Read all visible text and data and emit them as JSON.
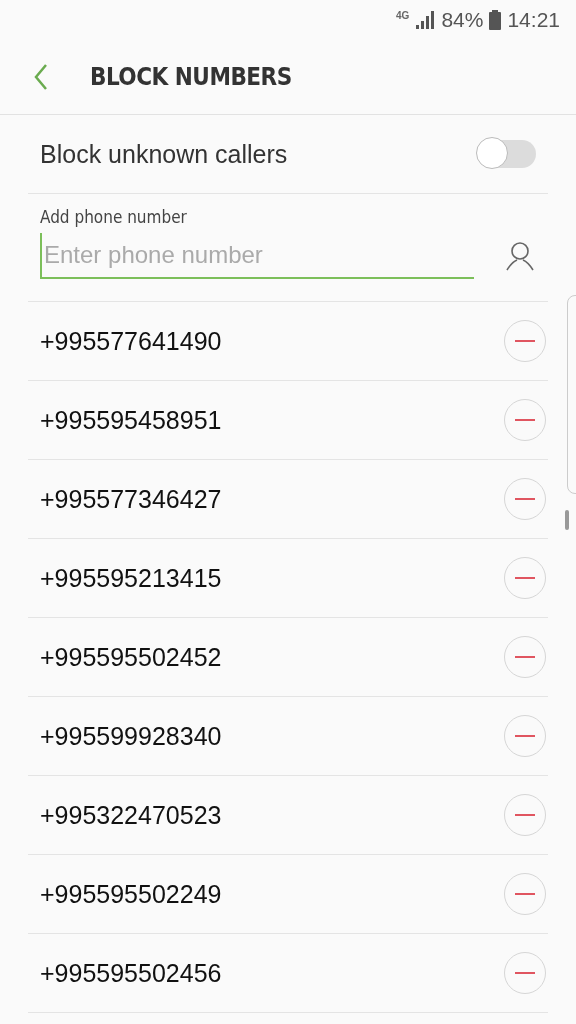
{
  "status_bar": {
    "network": "4G",
    "battery": "84%",
    "time": "14:21"
  },
  "header": {
    "title": "BLOCK NUMBERS"
  },
  "block_unknown": {
    "label": "Block unknown callers",
    "on": false
  },
  "add_field": {
    "label": "Add phone number",
    "placeholder": "Enter phone number"
  },
  "numbers": [
    "+995577641490",
    "+995595458951",
    "+995577346427",
    "+995595213415",
    "+995595502452",
    "+995599928340",
    "+995322470523",
    "+995595502249",
    "+995595502456"
  ]
}
